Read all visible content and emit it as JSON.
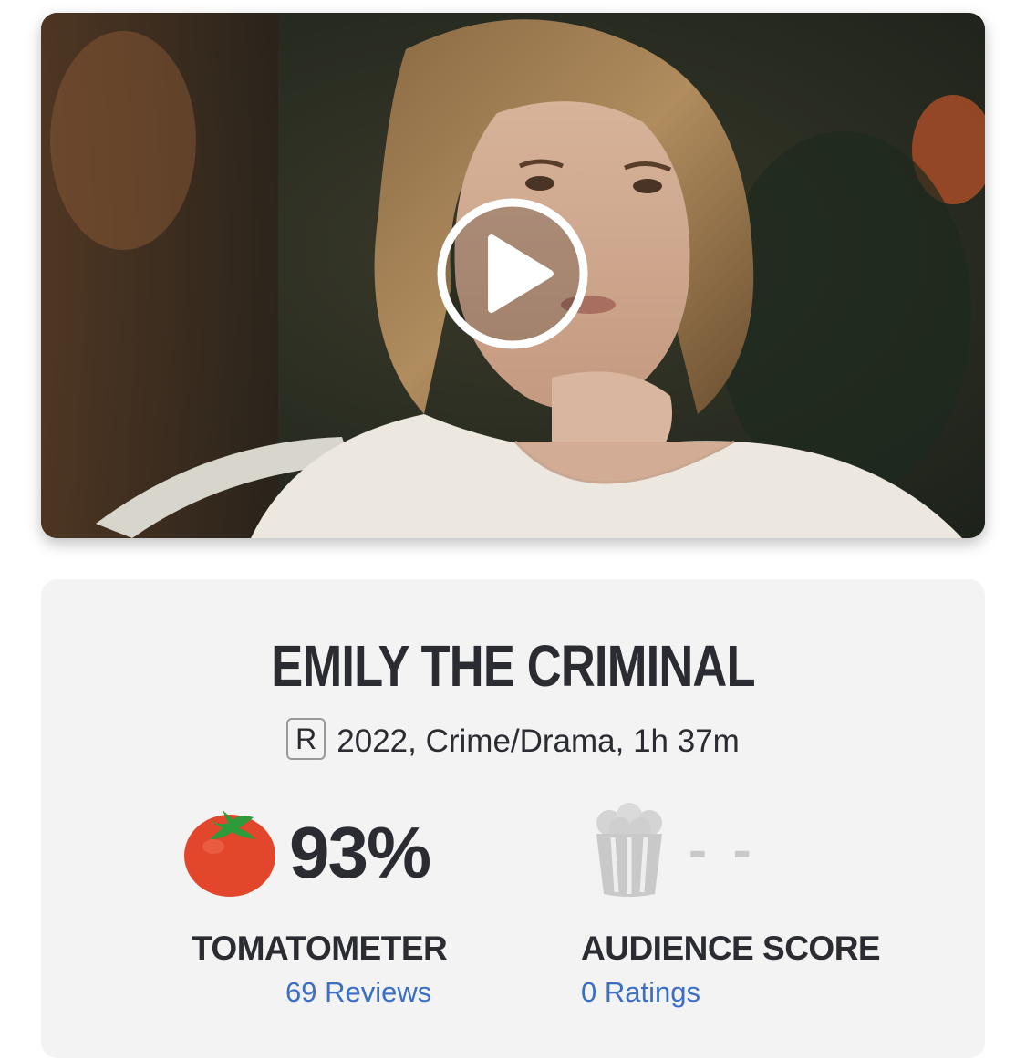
{
  "video": {
    "thumbnail_icon": "movie-still-image",
    "play_icon": "play-circle-icon"
  },
  "movie": {
    "title": "EMILY THE CRIMINAL",
    "rating": "R",
    "details": "2022, Crime/Drama, 1h 37m"
  },
  "tomatometer": {
    "icon": "fresh-tomato-icon",
    "score": "93%",
    "label": "TOMATOMETER",
    "reviews": "69 Reviews"
  },
  "audience": {
    "icon": "empty-popcorn-icon",
    "score": "- -",
    "label": "AUDIENCE SCORE",
    "ratings": "0 Ratings"
  },
  "colors": {
    "text": "#2a2c32",
    "link": "#3b6ec5",
    "card_bg": "#f3f3f3",
    "tomato": "#e2472b",
    "muted": "#c9c9c9"
  }
}
